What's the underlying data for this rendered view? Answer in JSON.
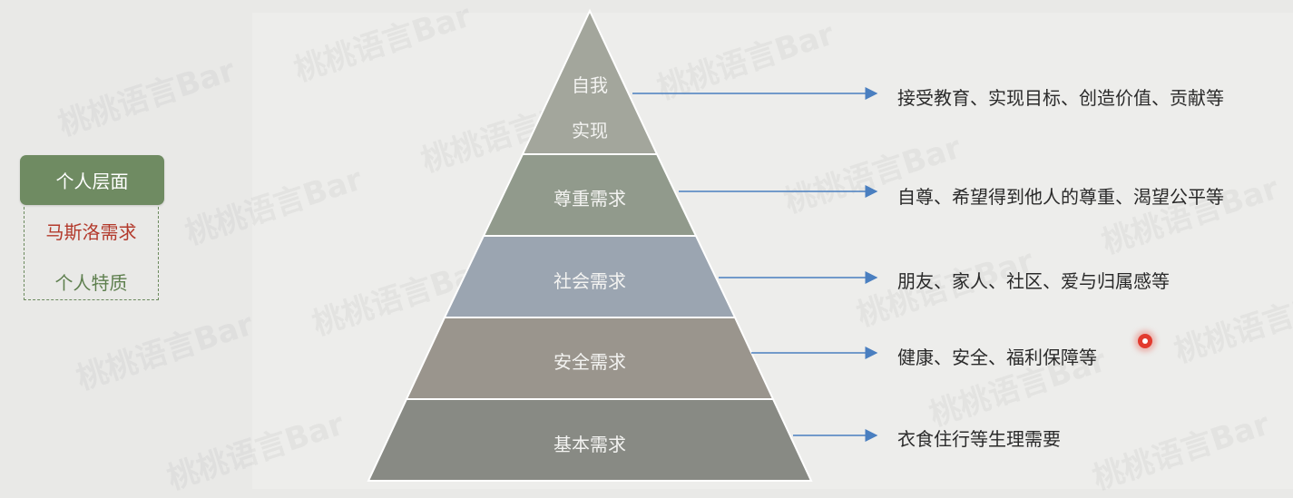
{
  "sidebar": {
    "header": "个人层面",
    "items": [
      {
        "label": "马斯洛需求",
        "color": "#b33a2c"
      },
      {
        "label": "个人特质",
        "color": "#5e7f4e"
      }
    ],
    "header_color": "#6f8b62"
  },
  "pyramid": {
    "levels": [
      {
        "label": "自我\n实现",
        "line1": "自我",
        "line2": "实现",
        "description": "接受教育、实现目标、创造价值、贡献等",
        "color": "#a3a69c"
      },
      {
        "label": "尊重需求",
        "description": "自尊、希望得到他人的尊重、渴望公平等",
        "color": "#919a8c"
      },
      {
        "label": "社会需求",
        "description": "朋友、家人、社区、爱与归属感等",
        "color": "#9ba5b1"
      },
      {
        "label": "安全需求",
        "description": "健康、安全、福利保障等",
        "color": "#9a958d"
      },
      {
        "label": "基本需求",
        "description": "衣食住行等生理需要",
        "color": "#888a84"
      }
    ],
    "arrow_color": "#4a7fc0"
  },
  "watermark": "桃桃语言Bar"
}
